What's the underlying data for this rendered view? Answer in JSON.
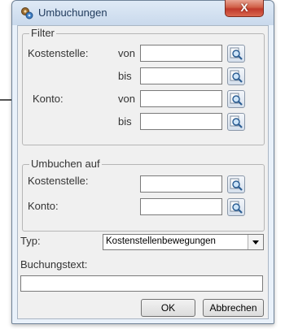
{
  "window": {
    "title": "Umbuchungen",
    "close_label": "X"
  },
  "filter": {
    "title": "Filter",
    "kostenstelle_label": "Kostenstelle:",
    "konto_label": "Konto:",
    "von": "von",
    "bis": "bis",
    "kostenstelle_von": "",
    "kostenstelle_bis": "",
    "konto_von": "",
    "konto_bis": ""
  },
  "umbuchen": {
    "title": "Umbuchen auf",
    "kostenstelle_label": "Kostenstelle:",
    "konto_label": "Konto:",
    "kostenstelle_value": "",
    "konto_value": ""
  },
  "typ": {
    "label": "Typ:",
    "selected": "Kostenstellenbewegungen"
  },
  "buchungstext": {
    "label": "Buchungstext:",
    "value": ""
  },
  "buttons": {
    "ok": "OK",
    "cancel": "Abbrechen"
  },
  "icons": {
    "app": "gears-icon",
    "lookup": "magnifier-icon"
  }
}
